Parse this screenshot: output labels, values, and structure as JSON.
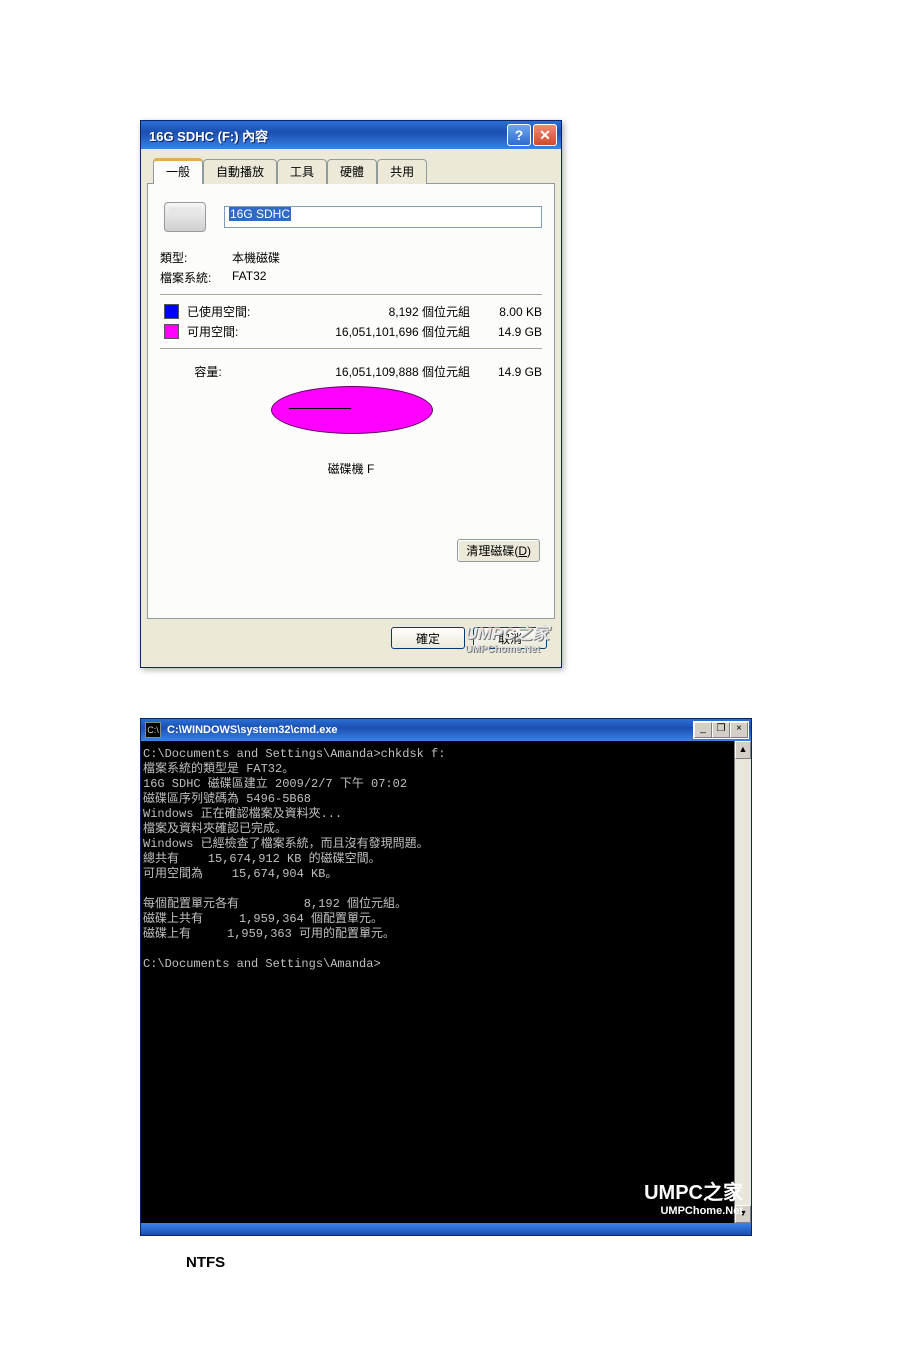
{
  "dialog": {
    "title": "16G SDHC (F:) 內容",
    "tabs": [
      "一般",
      "自動播放",
      "工具",
      "硬體",
      "共用"
    ],
    "volume_name": "16G SDHC",
    "type_label": "類型:",
    "type_value": "本機磁碟",
    "fs_label": "檔案系統:",
    "fs_value": "FAT32",
    "used_label": "已使用空間:",
    "used_bytes": "8,192 個位元組",
    "used_easy": "8.00 KB",
    "free_label": "可用空間:",
    "free_bytes": "16,051,101,696 個位元組",
    "free_easy": "14.9 GB",
    "cap_label": "容量:",
    "cap_bytes": "16,051,109,888 個位元組",
    "cap_easy": "14.9 GB",
    "disk_label": "磁碟機 F",
    "cleanup_btn": "清理磁碟(",
    "cleanup_accel": "D",
    "cleanup_btn_end": ")",
    "ok": "確定",
    "cancel": "取消",
    "watermark_big": "UMPC之家",
    "watermark_small": "UMPChome.Net"
  },
  "cmd": {
    "title": "C:\\WINDOWS\\system32\\cmd.exe",
    "icon_text": "C:\\",
    "output": "C:\\Documents and Settings\\Amanda>chkdsk f:\n檔案系統的類型是 FAT32。\n16G SDHC 磁碟區建立 2009/2/7 下午 07:02\n磁碟區序列號碼為 5496-5B68\nWindows 正在確認檔案及資料夾...\n檔案及資料夾確認已完成。\nWindows 已經檢查了檔案系統，而且沒有發現問題。\n總共有    15,674,912 KB 的磁碟空間。\n可用空間為    15,674,904 KB。\n\n每個配置單元各有         8,192 個位元組。\n磁碟上共有     1,959,364 個配置單元。\n磁碟上有     1,959,363 可用的配置單元。\n\nC:\\Documents and Settings\\Amanda>",
    "watermark_big": "UMPC之家",
    "watermark_small": "UMPChome.Net"
  },
  "footnote": "NTFS"
}
